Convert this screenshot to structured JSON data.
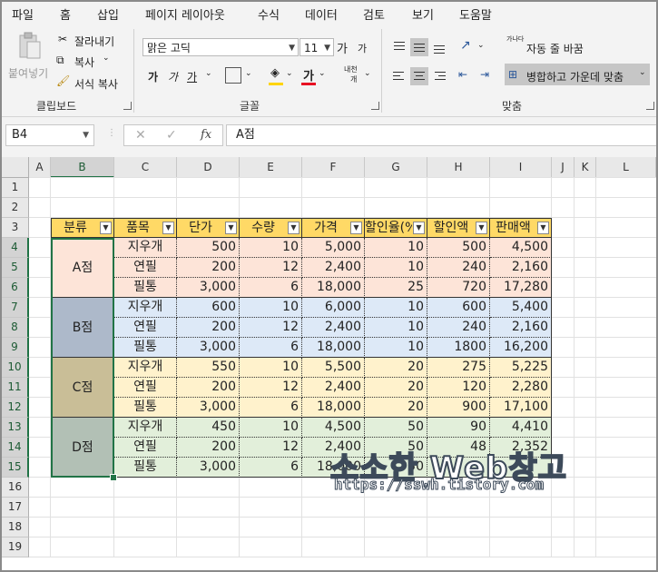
{
  "menu": {
    "tabs": [
      "파일",
      "홈",
      "삽입",
      "페이지 레이아웃",
      "수식",
      "데이터",
      "검토",
      "보기",
      "도움말"
    ],
    "active": "홈"
  },
  "ribbon": {
    "clipboard": {
      "paste": "붙여넣기",
      "cut": "잘라내기",
      "copy": "복사",
      "format_painter": "서식 복사",
      "group_label": "클립보드"
    },
    "font": {
      "font_name": "맑은 고딕",
      "font_size": "11",
      "grow": "가",
      "shrink": "가",
      "bold": "가",
      "italic": "가",
      "underline": "가",
      "font_color_glyph": "가",
      "phonetic_top": "내천",
      "phonetic_bottom": "개",
      "group_label": "글꼴"
    },
    "alignment": {
      "wrap_text": "자동 줄 바꿈",
      "merge_center": "병합하고 가운데 맞춤",
      "group_label": "맞춤",
      "wrap_icon_text": "가나다"
    },
    "colors": {
      "font_color": "#e81123",
      "fill_color": "#ffd400",
      "accent": "#217346"
    }
  },
  "formula_bar": {
    "name_box": "B4",
    "fx": "fx",
    "content": "A점"
  },
  "sheet": {
    "columns": [
      "A",
      "B",
      "C",
      "D",
      "E",
      "F",
      "G",
      "H",
      "I",
      "J",
      "K",
      "L"
    ],
    "rows": [
      "1",
      "2",
      "3",
      "4",
      "5",
      "6",
      "7",
      "8",
      "9",
      "10",
      "11",
      "12",
      "13",
      "14",
      "15",
      "16",
      "17",
      "18",
      "19"
    ],
    "selected_column": "B",
    "selected_rows": [
      "4",
      "5",
      "6",
      "7",
      "8",
      "9",
      "10",
      "11",
      "12",
      "13",
      "14",
      "15"
    ],
    "headers": [
      "분류",
      "품목",
      "단가",
      "수량",
      "가격",
      "할인율(%)",
      "할인액",
      "판매액"
    ],
    "groups": [
      {
        "name": "A점",
        "color": "#fde4d8",
        "label_color": "#fde4d8",
        "items": [
          [
            "지우개",
            "500",
            "10",
            "5,000",
            "10",
            "500",
            "4,500"
          ],
          [
            "연필",
            "200",
            "12",
            "2,400",
            "10",
            "240",
            "2,160"
          ],
          [
            "필통",
            "3,000",
            "6",
            "18,000",
            "25",
            "720",
            "17,280"
          ]
        ]
      },
      {
        "name": "B점",
        "color": "#dde9f7",
        "label_color": "#adb9ca",
        "items": [
          [
            "지우개",
            "600",
            "10",
            "6,000",
            "10",
            "600",
            "5,400"
          ],
          [
            "연필",
            "200",
            "12",
            "2,400",
            "10",
            "240",
            "2,160"
          ],
          [
            "필통",
            "3,000",
            "6",
            "18,000",
            "10",
            "1800",
            "16,200"
          ]
        ]
      },
      {
        "name": "C점",
        "color": "#fff2cc",
        "label_color": "#c9be97",
        "items": [
          [
            "지우개",
            "550",
            "10",
            "5,500",
            "20",
            "275",
            "5,225"
          ],
          [
            "연필",
            "200",
            "12",
            "2,400",
            "20",
            "120",
            "2,280"
          ],
          [
            "필통",
            "3,000",
            "6",
            "18,000",
            "20",
            "900",
            "17,100"
          ]
        ]
      },
      {
        "name": "D점",
        "color": "#e2efda",
        "label_color": "#b2c0b5",
        "items": [
          [
            "지우개",
            "450",
            "10",
            "4,500",
            "50",
            "90",
            "4,410"
          ],
          [
            "연필",
            "200",
            "12",
            "2,400",
            "50",
            "48",
            "2,352"
          ],
          [
            "필통",
            "3,000",
            "6",
            "18,000",
            "50",
            "",
            ""
          ]
        ]
      }
    ]
  },
  "watermark": {
    "title": "소소한 Web창고",
    "url": "https://sswh.tistory.com"
  }
}
